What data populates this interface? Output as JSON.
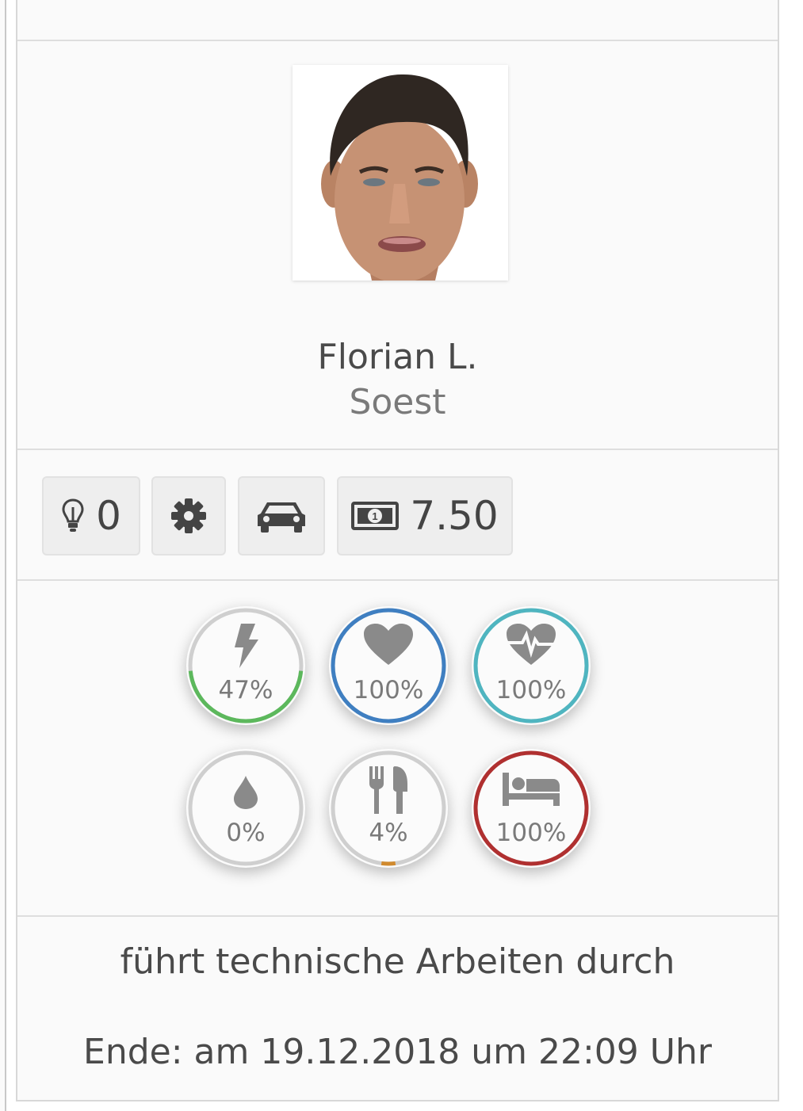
{
  "profile": {
    "name": "Florian L.",
    "city": "Soest",
    "avatar_alt": "Portrait"
  },
  "toolbar": {
    "ideas_count": "0",
    "money_amount": "7.50"
  },
  "stats": [
    {
      "key": "energy",
      "icon": "lightning-icon",
      "value": "47%",
      "fraction": 0.47,
      "color": "#5cb85c"
    },
    {
      "key": "love",
      "icon": "heart-icon",
      "value": "100%",
      "fraction": 1.0,
      "color": "#3f7fc1"
    },
    {
      "key": "health",
      "icon": "heartbeat-icon",
      "value": "100%",
      "fraction": 1.0,
      "color": "#4fb5c0"
    },
    {
      "key": "thirst",
      "icon": "drop-icon",
      "value": "0%",
      "fraction": 0.0,
      "color": "#c8c8c8"
    },
    {
      "key": "hunger",
      "icon": "cutlery-icon",
      "value": "4%",
      "fraction": 0.04,
      "color": "#d08a2e"
    },
    {
      "key": "sleep",
      "icon": "bed-icon",
      "value": "100%",
      "fraction": 1.0,
      "color": "#b03030"
    }
  ],
  "activity": {
    "status": "führt technische Arbeiten durch",
    "end": "Ende: am 19.12.2018 um 22:09 Uhr"
  }
}
